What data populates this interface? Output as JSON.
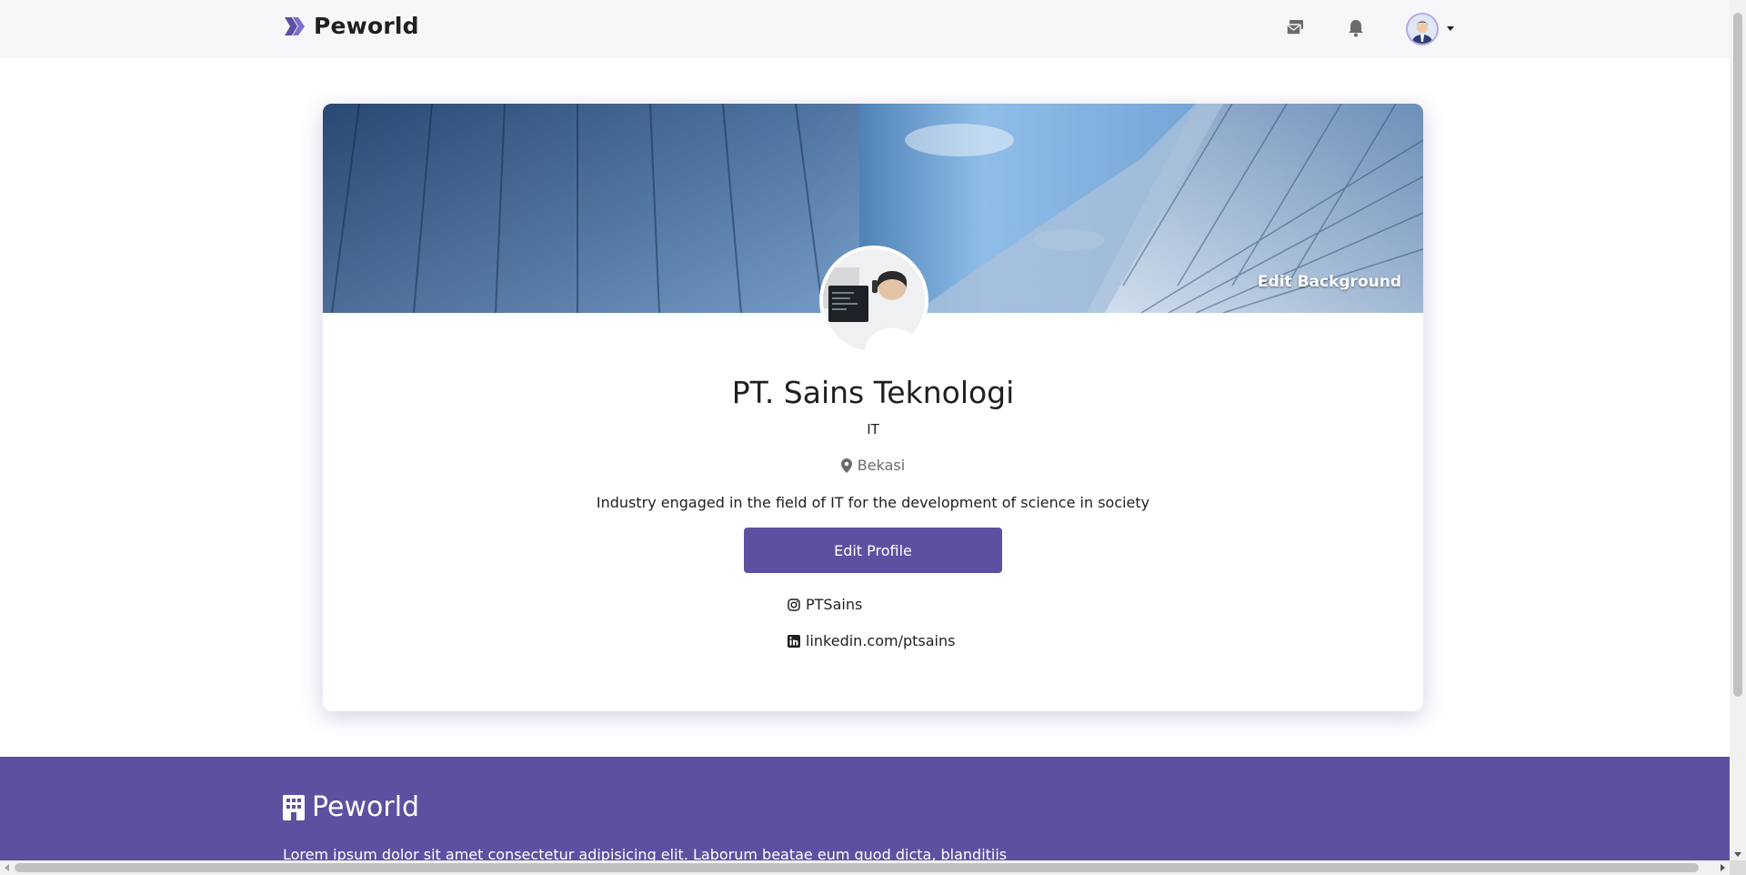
{
  "navbar": {
    "brand": "Peworld",
    "icons": [
      "brand-chevrons-icon",
      "mail-icon",
      "bell-icon",
      "avatar",
      "caret-down-icon"
    ]
  },
  "profile": {
    "edit_background_label": "Edit Background",
    "company_name": "PT. Sains Teknologi",
    "field": "IT",
    "location": "Bekasi",
    "description": "Industry engaged in the field of IT for the development of science in society",
    "edit_profile_label": "Edit Profile",
    "socials": {
      "instagram": "PTSains",
      "linkedin": "linkedin.com/ptsains"
    }
  },
  "footer": {
    "brand": "Peworld",
    "description": "Lorem ipsum dolor sit amet consectetur adipisicing elit. Laborum beatae eum quod dicta, blanditiis"
  },
  "colors": {
    "primary": "#5e50a1",
    "navbar_bg": "#f6f7f8",
    "text": "#1f1f1f",
    "muted": "#6b6b6b"
  }
}
